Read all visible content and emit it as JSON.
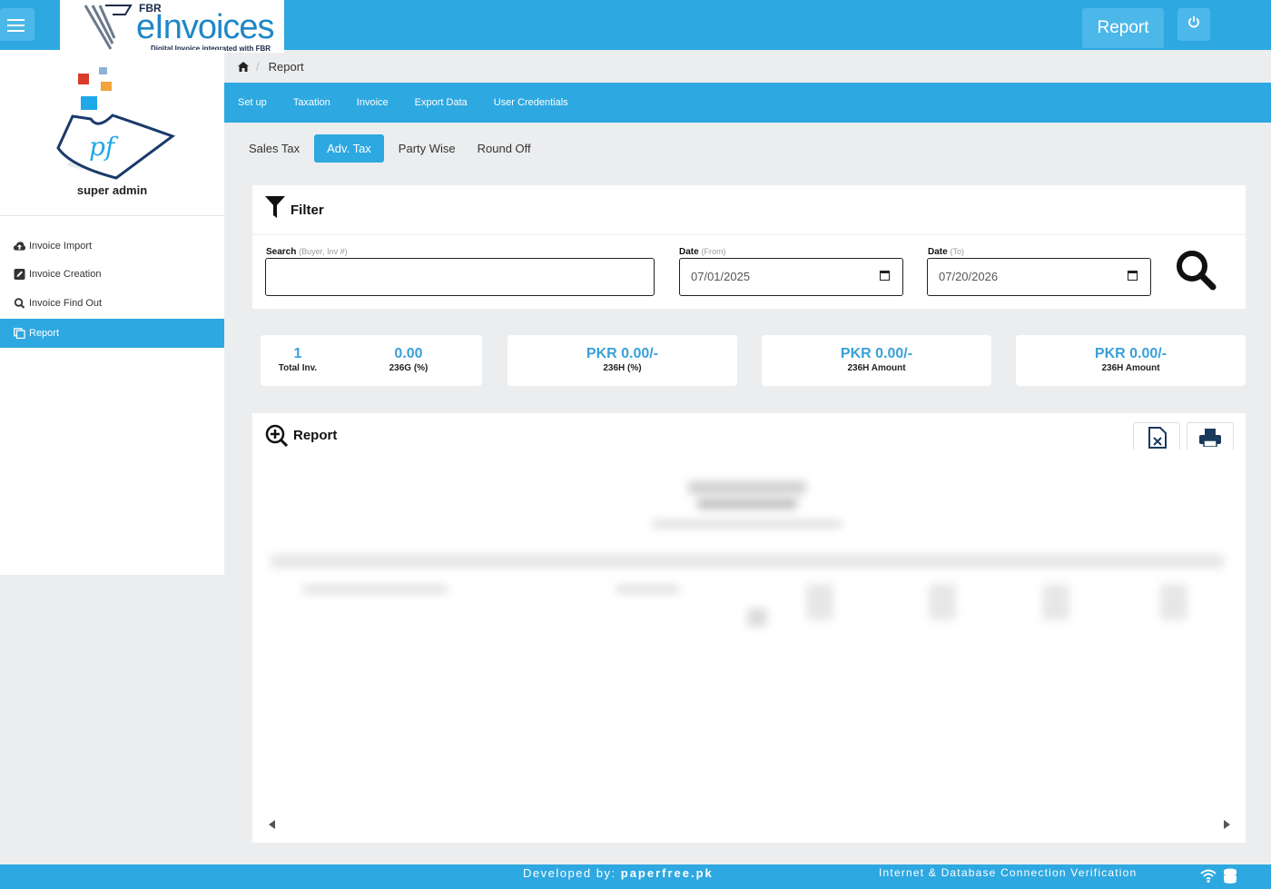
{
  "header": {
    "logo_prefix": "FBR",
    "logo_main": "eInvoices",
    "logo_tagline": "Digital Invoice integrated with FBR",
    "report_button": "Report",
    "power_icon": "power-icon"
  },
  "sidebar": {
    "user_name": "super admin",
    "items": [
      {
        "label": "Invoice Import",
        "icon": "cloud-upload-icon"
      },
      {
        "label": "Invoice Creation",
        "icon": "edit-icon"
      },
      {
        "label": "Invoice Find Out",
        "icon": "search-icon"
      },
      {
        "label": "Report",
        "icon": "copy-icon",
        "active": true
      }
    ]
  },
  "breadcrumb": {
    "home_icon": "home-icon",
    "current": "Report"
  },
  "menu": [
    "Set up",
    "Taxation",
    "Invoice",
    "Export Data",
    "User Credentials"
  ],
  "tabs": [
    {
      "label": "Sales Tax"
    },
    {
      "label": "Adv. Tax",
      "active": true
    },
    {
      "label": "Party Wise"
    },
    {
      "label": "Round Off"
    }
  ],
  "filter": {
    "title": "Filter",
    "search_label": "Search",
    "search_hint": "(Buyer, Inv #)",
    "search_value": "",
    "date_from_label": "Date",
    "date_from_hint": "(From)",
    "date_from_value": "07/01/2025",
    "date_to_label": "Date",
    "date_to_hint": "(To)",
    "date_to_value": "07/20/2026"
  },
  "stats": {
    "total_inv_value": "1",
    "total_inv_label": "Total Inv.",
    "g236_value": "0.00",
    "g236_label": "236G (%)",
    "h236_value": "PKR 0.00/-",
    "h236_label": "236H (%)",
    "h236_amount_value": "PKR 0.00/-",
    "h236_amount_label": "236H Amount",
    "h236_amount2_value": "PKR 0.00/-",
    "h236_amount2_label": "236H Amount"
  },
  "report": {
    "title": "Report",
    "export_excel_icon": "excel-export-icon",
    "print_icon": "print-icon"
  },
  "footer": {
    "developed_prefix": "Developed by:",
    "developed_by": "paperfree.pk",
    "verification": "Internet & Database Connection Verification",
    "wifi_icon": "wifi-icon",
    "db_icon": "database-icon"
  },
  "colors": {
    "primary": "#2ea8e0",
    "stat_value": "#3aa0d9"
  }
}
